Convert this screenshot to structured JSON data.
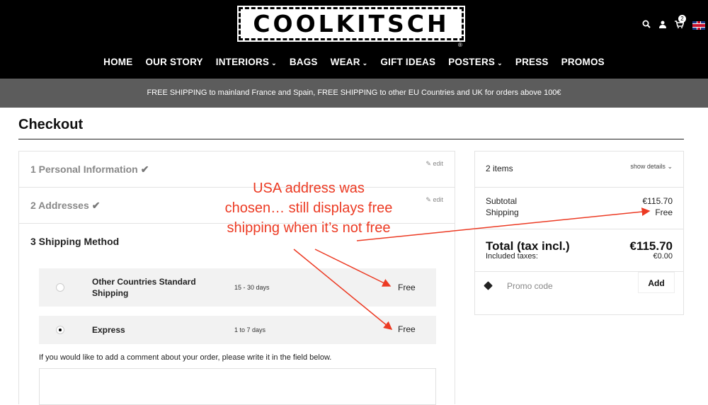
{
  "header": {
    "logo_text": "COOLKITSCH",
    "registered_mark": "®",
    "cart_count": "2",
    "icons": [
      "search-icon",
      "user-icon",
      "cart-icon",
      "uk-flag-icon"
    ]
  },
  "nav": {
    "items": [
      {
        "label": "HOME",
        "dropdown": false
      },
      {
        "label": "OUR STORY",
        "dropdown": false
      },
      {
        "label": "INTERIORS",
        "dropdown": true
      },
      {
        "label": "BAGS",
        "dropdown": false
      },
      {
        "label": "WEAR",
        "dropdown": true
      },
      {
        "label": "GIFT IDEAS",
        "dropdown": false
      },
      {
        "label": "POSTERS",
        "dropdown": true
      },
      {
        "label": "PRESS",
        "dropdown": false
      },
      {
        "label": "PROMOS",
        "dropdown": false
      }
    ]
  },
  "promo_bar": {
    "text": "FREE SHIPPING to mainland France and Spain, FREE SHIPPING to other EU Countries and UK for orders above 100€"
  },
  "page": {
    "title": "Checkout"
  },
  "steps": [
    {
      "label": "1 Personal Information",
      "done": true,
      "edit": "edit"
    },
    {
      "label": "2 Addresses",
      "done": true,
      "edit": "edit"
    },
    {
      "label": "3 Shipping Method",
      "done": false
    }
  ],
  "shipping_options": [
    {
      "name": "Other Countries Standard Shipping",
      "delay": "15 - 30 days",
      "price": "Free",
      "selected": false
    },
    {
      "name": "Express",
      "delay": "1 to 7 days",
      "price": "Free",
      "selected": true
    }
  ],
  "comment": {
    "label": "If you would like to add a comment about your order, please write it in the field below."
  },
  "summary": {
    "items_count": "2 items",
    "show_details": "show details",
    "subtotal_label": "Subtotal",
    "subtotal_value": "€115.70",
    "shipping_label": "Shipping",
    "shipping_value": "Free",
    "total_label": "Total (tax incl.)",
    "total_value": "€115.70",
    "taxes_label": "Included taxes:",
    "taxes_value": "€0.00",
    "promo_placeholder": "Promo code",
    "promo_button": "Add"
  },
  "annotation": {
    "lines": [
      "USA address was",
      "chosen… still displays free",
      "shipping when it’s not free"
    ],
    "color": "#ec3a23"
  }
}
